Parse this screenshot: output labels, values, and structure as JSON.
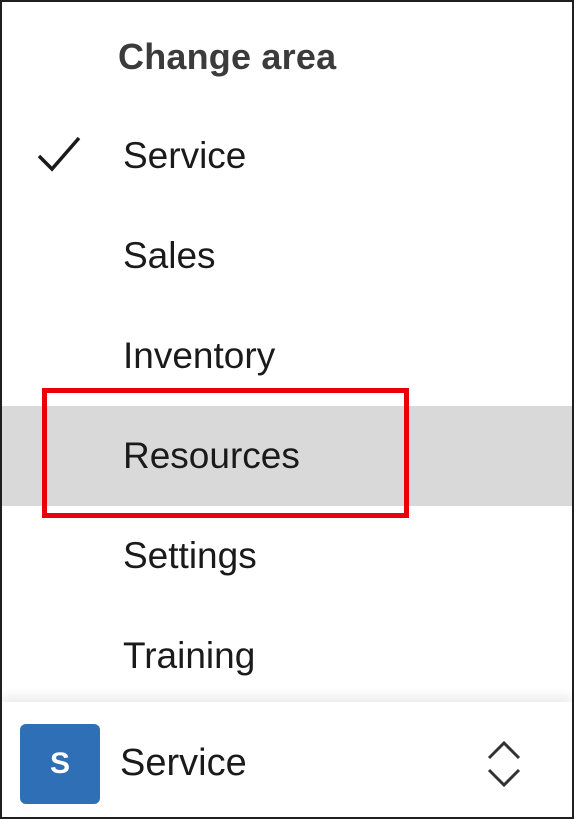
{
  "menu": {
    "header": "Change area",
    "selected": "Service",
    "items": [
      {
        "label": "Service"
      },
      {
        "label": "Sales"
      },
      {
        "label": "Inventory"
      },
      {
        "label": "Resources"
      },
      {
        "label": "Settings"
      },
      {
        "label": "Training"
      }
    ]
  },
  "footer": {
    "avatar_letter": "S",
    "avatar_color": "#2f6fb5",
    "area_name": "Service",
    "switcher_icon": "chevron-up-down-icon"
  },
  "colors": {
    "hover_background": "#d9d9d9",
    "annotation_outline": "#e8000b"
  },
  "icons": {
    "selected_marker": "checkmark-icon"
  }
}
